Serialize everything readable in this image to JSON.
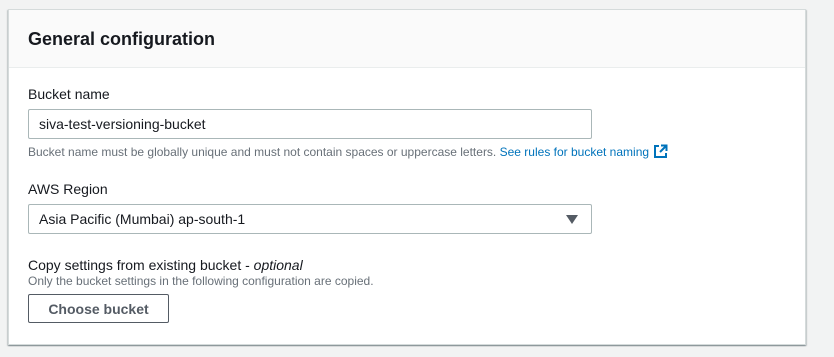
{
  "panel": {
    "title": "General configuration"
  },
  "bucket_name": {
    "label": "Bucket name",
    "value": "siva-test-versioning-bucket",
    "hint": "Bucket name must be globally unique and must not contain spaces or uppercase letters.",
    "rules_link": "See rules for bucket naming",
    "link_icon": "external-link-icon",
    "link_color": "#0073bb"
  },
  "region": {
    "label": "AWS Region",
    "selected": "Asia Pacific (Mumbai) ap-south-1",
    "caret_icon": "caret-down-icon"
  },
  "copy_settings": {
    "label": "Copy settings from existing bucket - ",
    "optional": "optional",
    "hint": "Only the bucket settings in the following configuration are copied.",
    "button": "Choose bucket"
  }
}
